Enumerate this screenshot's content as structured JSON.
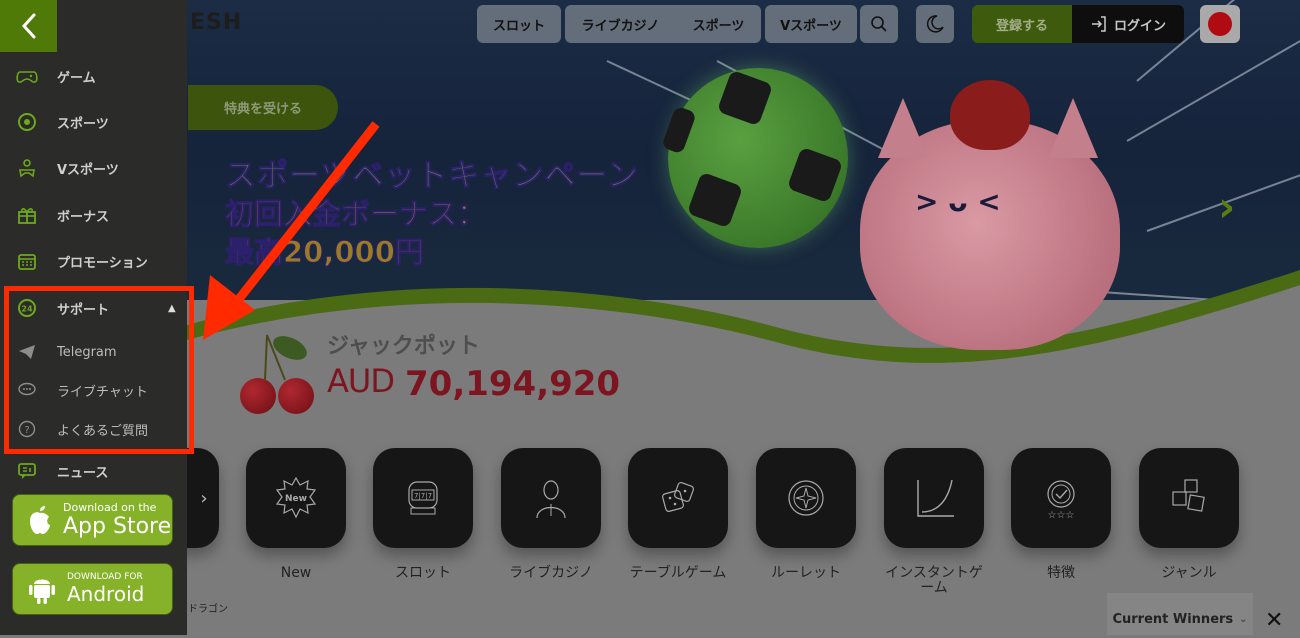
{
  "header": {
    "logo_partial": "ESH",
    "nav": [
      {
        "label": "スロット"
      },
      {
        "label": "ライブカジノ"
      },
      {
        "label": "スポーツ"
      },
      {
        "label": "Vスポーツ"
      }
    ],
    "search_icon": "search-icon",
    "theme_icon": "moon-icon",
    "register_label": "登録する",
    "login_label": "ログイン",
    "language_flag": "japan-flag"
  },
  "sidebar": {
    "back_icon": "chevron-left-icon",
    "items": [
      {
        "label": "ゲーム",
        "icon": "gamepad-icon"
      },
      {
        "label": "スポーツ",
        "icon": "soccer-ball-icon"
      },
      {
        "label": "Vスポーツ",
        "icon": "virtual-sports-icon"
      },
      {
        "label": "ボーナス",
        "icon": "gift-icon"
      },
      {
        "label": "プロモーション",
        "icon": "calendar-icon"
      },
      {
        "label": "サポート",
        "icon": "support-24-icon",
        "expanded": true
      }
    ],
    "support_sub": [
      {
        "label": "Telegram",
        "icon": "telegram-icon"
      },
      {
        "label": "ライブチャット",
        "icon": "chat-icon"
      },
      {
        "label": "よくあるご質問",
        "icon": "question-icon"
      }
    ],
    "news": {
      "label": "ニュース",
      "icon": "news-icon"
    },
    "app_store": {
      "line1": "Download on the",
      "line2": "App Store"
    },
    "android": {
      "line1": "DOWNLOAD FOR",
      "line2": "Android"
    }
  },
  "banner": {
    "cta": "特典を受ける",
    "title": "スポーツベットキャンペーン",
    "subtitle_1": "初回入金ボーナス：",
    "subtitle_2": "最高20,000円"
  },
  "jackpot": {
    "label": "ジャックポット",
    "currency": "AUD",
    "amount": "70,194,920"
  },
  "categories": [
    {
      "label": "",
      "icon": "dragon-icon"
    },
    {
      "label": "New",
      "icon": "new-badge-icon"
    },
    {
      "label": "スロット",
      "icon": "slot-machine-icon"
    },
    {
      "label": "ライブカジノ",
      "icon": "live-dealer-icon"
    },
    {
      "label": "テーブルゲーム",
      "icon": "dice-icon"
    },
    {
      "label": "ルーレット",
      "icon": "roulette-icon"
    },
    {
      "label": "インスタントゲーム",
      "icon": "curve-chart-icon"
    },
    {
      "label": "特徴",
      "icon": "award-icon"
    },
    {
      "label": "ジャンル",
      "icon": "cubes-icon"
    }
  ],
  "partial_label": "ドラゴン",
  "winners": {
    "label": "Current Winners"
  },
  "colors": {
    "accent": "#4f7a07",
    "highlight": "#ff2a00",
    "jackpot": "#7d1520"
  }
}
